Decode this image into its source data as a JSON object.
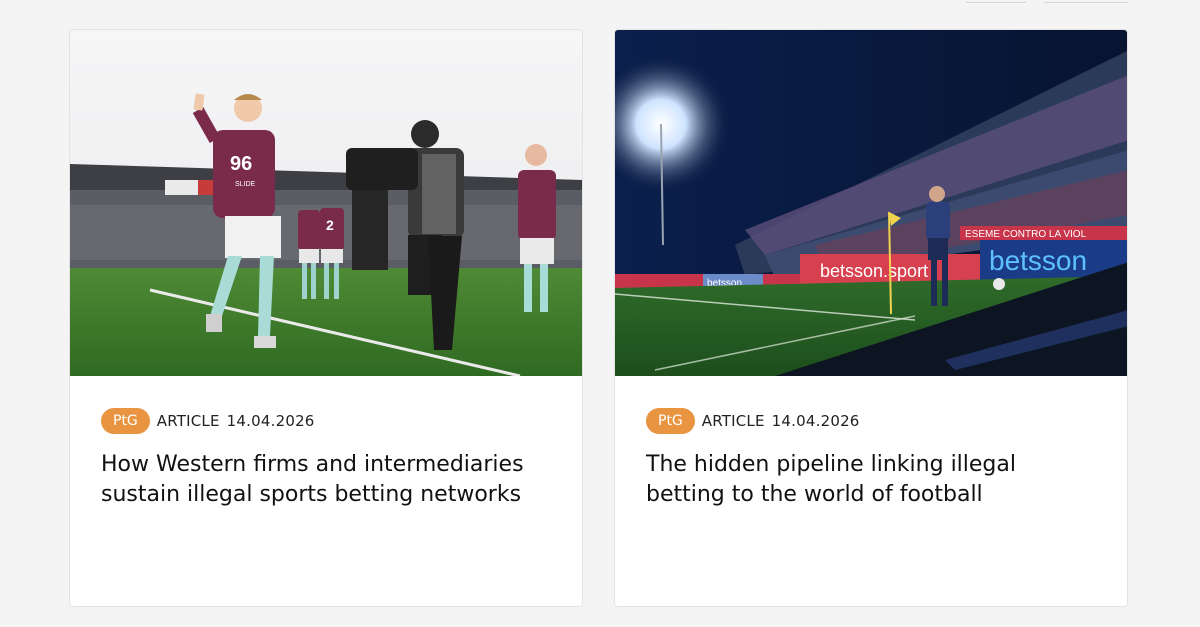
{
  "articles": [
    {
      "image_alt": "Burnley players celebrating a goal while a cameraman films",
      "tag": "PtG",
      "type": "ARTICLE",
      "date": "14.04.2026",
      "title": "How Western firms and intermediaries sustain illegal sports betting networks",
      "shirt_numbers": [
        "96",
        "2"
      ],
      "sponsor_text": "SLIDE"
    },
    {
      "image_alt": "Football match at night under floodlights with sponsor boards",
      "tag": "PtG",
      "type": "ARTICLE",
      "date": "14.04.2026",
      "title": "The hidden pipeline linking illegal betting to the world of football",
      "board_texts": [
        "betsson.sport",
        "betsson",
        "betsson",
        "ESEME CONTRO LA VIOL"
      ]
    }
  ],
  "colors": {
    "badge": "#e89440",
    "page_bg": "#f4f4f4",
    "card_bg": "#ffffff",
    "claret": "#7a2b49"
  }
}
